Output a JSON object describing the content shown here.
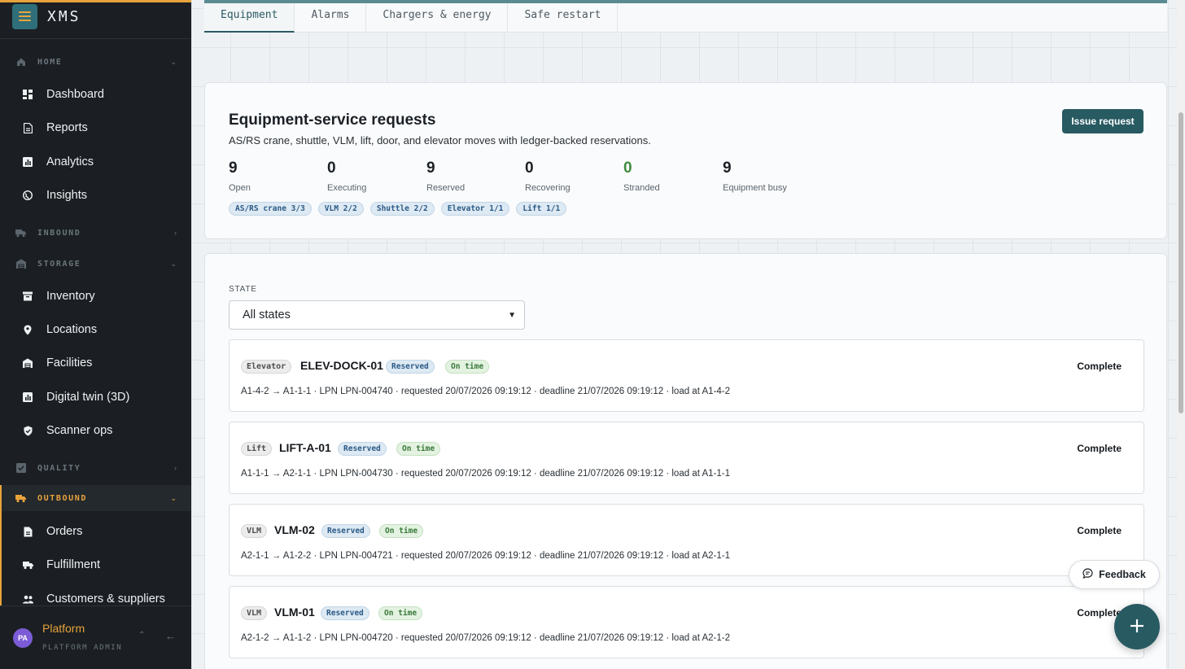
{
  "app": {
    "name": "XMS"
  },
  "sidebar": {
    "home": {
      "label": "HOME",
      "items": [
        {
          "label": "Dashboard",
          "icon": "dashboard-icon"
        },
        {
          "label": "Reports",
          "icon": "report-icon"
        },
        {
          "label": "Analytics",
          "icon": "analytics-icon"
        },
        {
          "label": "Insights",
          "icon": "globe-icon"
        }
      ]
    },
    "inbound": {
      "label": "INBOUND"
    },
    "storage": {
      "label": "STORAGE",
      "items": [
        {
          "label": "Inventory",
          "icon": "inventory-icon"
        },
        {
          "label": "Locations",
          "icon": "location-pin-icon"
        },
        {
          "label": "Facilities",
          "icon": "facility-icon"
        },
        {
          "label": "Digital twin (3D)",
          "icon": "digital-twin-icon"
        },
        {
          "label": "Scanner ops",
          "icon": "shield-check-icon"
        }
      ]
    },
    "quality": {
      "label": "QUALITY"
    },
    "outbound": {
      "label": "OUTBOUND",
      "items": [
        {
          "label": "Orders",
          "icon": "order-icon"
        },
        {
          "label": "Fulfillment",
          "icon": "truck-icon"
        },
        {
          "label": "Customers & suppliers",
          "icon": "people-icon"
        }
      ]
    },
    "user": {
      "initials": "PA",
      "name": "Platform",
      "role": "PLATFORM ADMIN"
    }
  },
  "tabs": [
    "Equipment",
    "Alarms",
    "Chargers & energy",
    "Safe restart"
  ],
  "summary": {
    "title": "Equipment-service requests",
    "subtitle": "AS/RS crane, shuttle, VLM, lift, door, and elevator moves with ledger-backed reservations.",
    "action": "Issue request",
    "stats": [
      {
        "value": "9",
        "label": "Open"
      },
      {
        "value": "0",
        "label": "Executing"
      },
      {
        "value": "9",
        "label": "Reserved"
      },
      {
        "value": "0",
        "label": "Recovering"
      },
      {
        "value": "0",
        "label": "Stranded"
      },
      {
        "value": "9",
        "label": "Equipment busy"
      }
    ],
    "chips": [
      "AS/RS crane 3/3",
      "VLM 2/2",
      "Shuttle 2/2",
      "Elevator 1/1",
      "Lift 1/1"
    ]
  },
  "filter": {
    "label": "STATE",
    "value": "All states"
  },
  "requests": [
    {
      "kind": "Elevator",
      "name": "ELEV-DOCK-01",
      "state": "Reserved",
      "timing": "On time",
      "action": "Complete",
      "detail": "A1-4-2 → A1-1-1 · LPN LPN-004740 · requested 20/07/2026 09:19:12 · deadline 21/07/2026 09:19:12 · load at A1-4-2"
    },
    {
      "kind": "Lift",
      "name": "LIFT-A-01",
      "state": "Reserved",
      "timing": "On time",
      "action": "Complete",
      "detail": "A1-1-1 → A2-1-1 · LPN LPN-004730 · requested 20/07/2026 09:19:12 · deadline 21/07/2026 09:19:12 · load at A1-1-1"
    },
    {
      "kind": "VLM",
      "name": "VLM-02",
      "state": "Reserved",
      "timing": "On time",
      "action": "Complete",
      "detail": "A2-1-1 → A1-2-2 · LPN LPN-004721 · requested 20/07/2026 09:19:12 · deadline 21/07/2026 09:19:12 · load at A2-1-1"
    },
    {
      "kind": "VLM",
      "name": "VLM-01",
      "state": "Reserved",
      "timing": "On time",
      "action": "Complete",
      "detail": "A2-1-2 → A1-1-2 · LPN LPN-004720 · requested 20/07/2026 09:19:12 · deadline 21/07/2026 09:19:12 · load at A2-1-2"
    }
  ],
  "feedback": {
    "label": "Feedback"
  },
  "colors": {
    "accent": "#e8a33c",
    "primary": "#285a62",
    "sidebar": "#1b1f23",
    "success": "#3f8a3e"
  }
}
